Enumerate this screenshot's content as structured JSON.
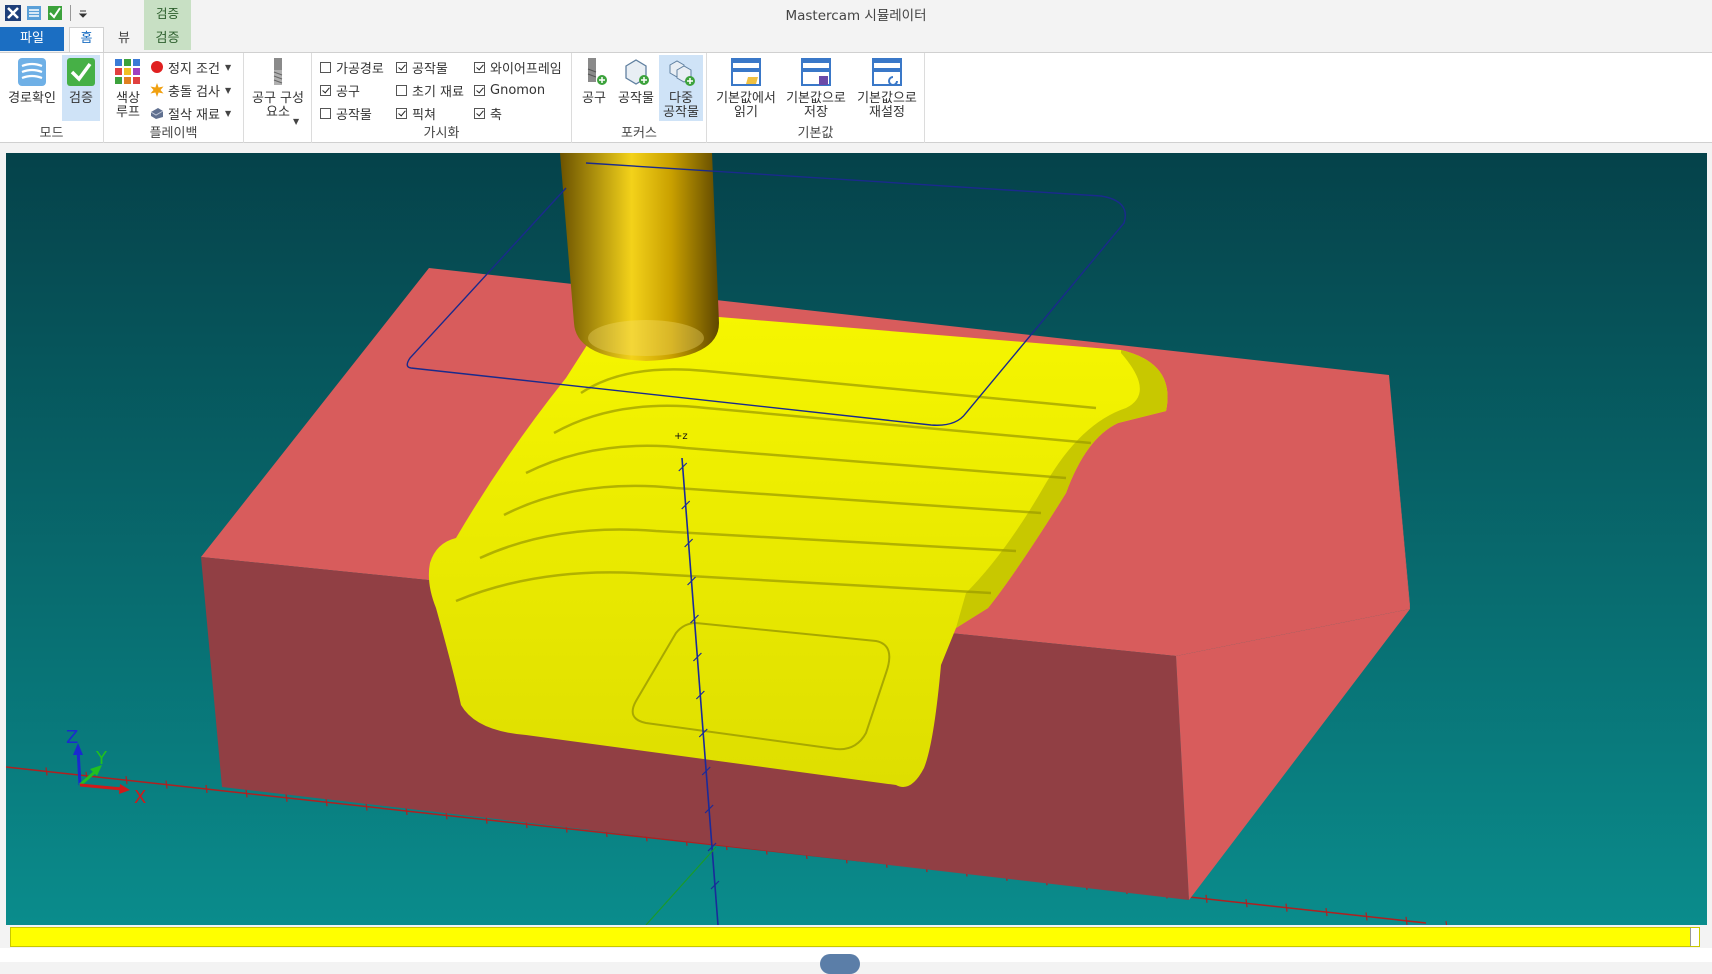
{
  "window": {
    "title": "Mastercam 시뮬레이터"
  },
  "context_group": {
    "label": "검증"
  },
  "tabs": {
    "file": "파일",
    "home": "홈",
    "view": "뷰",
    "verify": "검증"
  },
  "ribbon": {
    "mode": {
      "label": "모드",
      "path_check": "경로확인",
      "verify": "검증"
    },
    "playback": {
      "label": "플레이백",
      "color_loop": "색상\n루프",
      "stop_conditions": "정지 조건",
      "collision_check": "충돌 검사",
      "cut_stock": "절삭 재료"
    },
    "tool_components": {
      "label": "공구 구성\n요소"
    },
    "visibility": {
      "label": "가시화",
      "items": [
        {
          "label": "가공경로",
          "checked": false
        },
        {
          "label": "공작물",
          "checked": true
        },
        {
          "label": "와이어프레임",
          "checked": true
        },
        {
          "label": "공구",
          "checked": true
        },
        {
          "label": "초기 재료",
          "checked": false
        },
        {
          "label": "Gnomon",
          "checked": true
        },
        {
          "label": "공작물",
          "checked": false
        },
        {
          "label": "픽쳐",
          "checked": true
        },
        {
          "label": "축",
          "checked": true
        }
      ]
    },
    "focus": {
      "label": "포커스",
      "tool": "공구",
      "workpiece": "공작물",
      "multi_workpiece": "다중\n공작물"
    },
    "defaults": {
      "label": "기본값",
      "load": "기본값에서\n읽기",
      "save": "기본값으로\n저장",
      "reset": "기본값으로\n재설정"
    }
  },
  "viewport": {
    "axis_marker": "+z",
    "gnomon": {
      "x": "X",
      "y": "Y",
      "z": "Z"
    },
    "colors": {
      "background_top": "#05424a",
      "background_bottom": "#0a8c8c",
      "stock": "#d85c5c",
      "stock_side": "#913f44",
      "cut_surface": "#f0f000",
      "tool": "#c9a000",
      "wireframe": "#1a2a8c"
    }
  },
  "progress": {
    "fraction": 1.0
  }
}
